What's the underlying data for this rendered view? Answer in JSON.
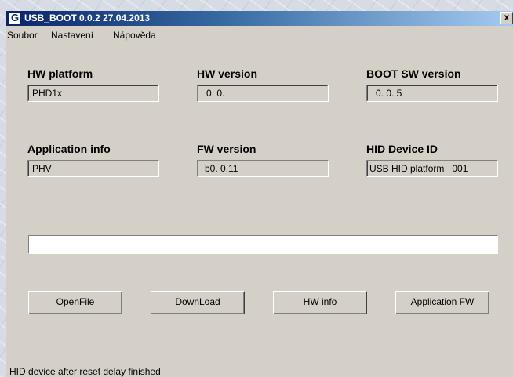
{
  "window": {
    "title": "USB_BOOT  0.0.2 27.04.2013",
    "app_icon_glyph": "G",
    "close_glyph": "x"
  },
  "menu": {
    "items": [
      "Soubor",
      "Nastavení",
      "Nápověda"
    ]
  },
  "fields": {
    "hw_platform": {
      "label": "HW platform",
      "value": "PHD1x"
    },
    "hw_version": {
      "label": "HW version",
      "value": "0. 0."
    },
    "boot_sw_version": {
      "label": "BOOT SW version",
      "value": "0. 0. 5"
    },
    "application_info": {
      "label": "Application info",
      "value": "PHV"
    },
    "fw_version": {
      "label": "FW version",
      "value": "b0. 0.11"
    },
    "hid_device_id": {
      "label": "HID Device ID",
      "value": "USB HID platform   001"
    }
  },
  "progress": {
    "value": 0
  },
  "buttons": {
    "open_file": "OpenFile",
    "download": "DownLoad",
    "hw_info": "HW info",
    "application_fw": "Application FW"
  },
  "status": {
    "text": "HID device after reset delay finished"
  },
  "colors": {
    "titlebar_start": "#0a246a",
    "titlebar_end": "#a6caf0",
    "window_bg": "#d4d0c8"
  }
}
